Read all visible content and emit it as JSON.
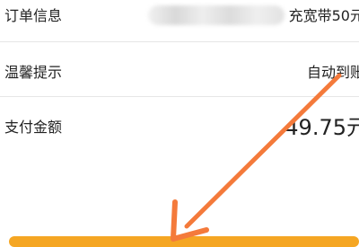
{
  "order_info": {
    "label": "订单信息",
    "value": "充宽带50元"
  },
  "tips": {
    "label": "温馨提示",
    "value": "自动到账"
  },
  "payment": {
    "label": "支付金额",
    "value": "49.75元"
  },
  "colors": {
    "accent": "#f5a623",
    "arrow": "#f47a3b",
    "divider": "#e6e6e6"
  },
  "icons": {
    "arrow": "arrow-annotation-icon"
  }
}
